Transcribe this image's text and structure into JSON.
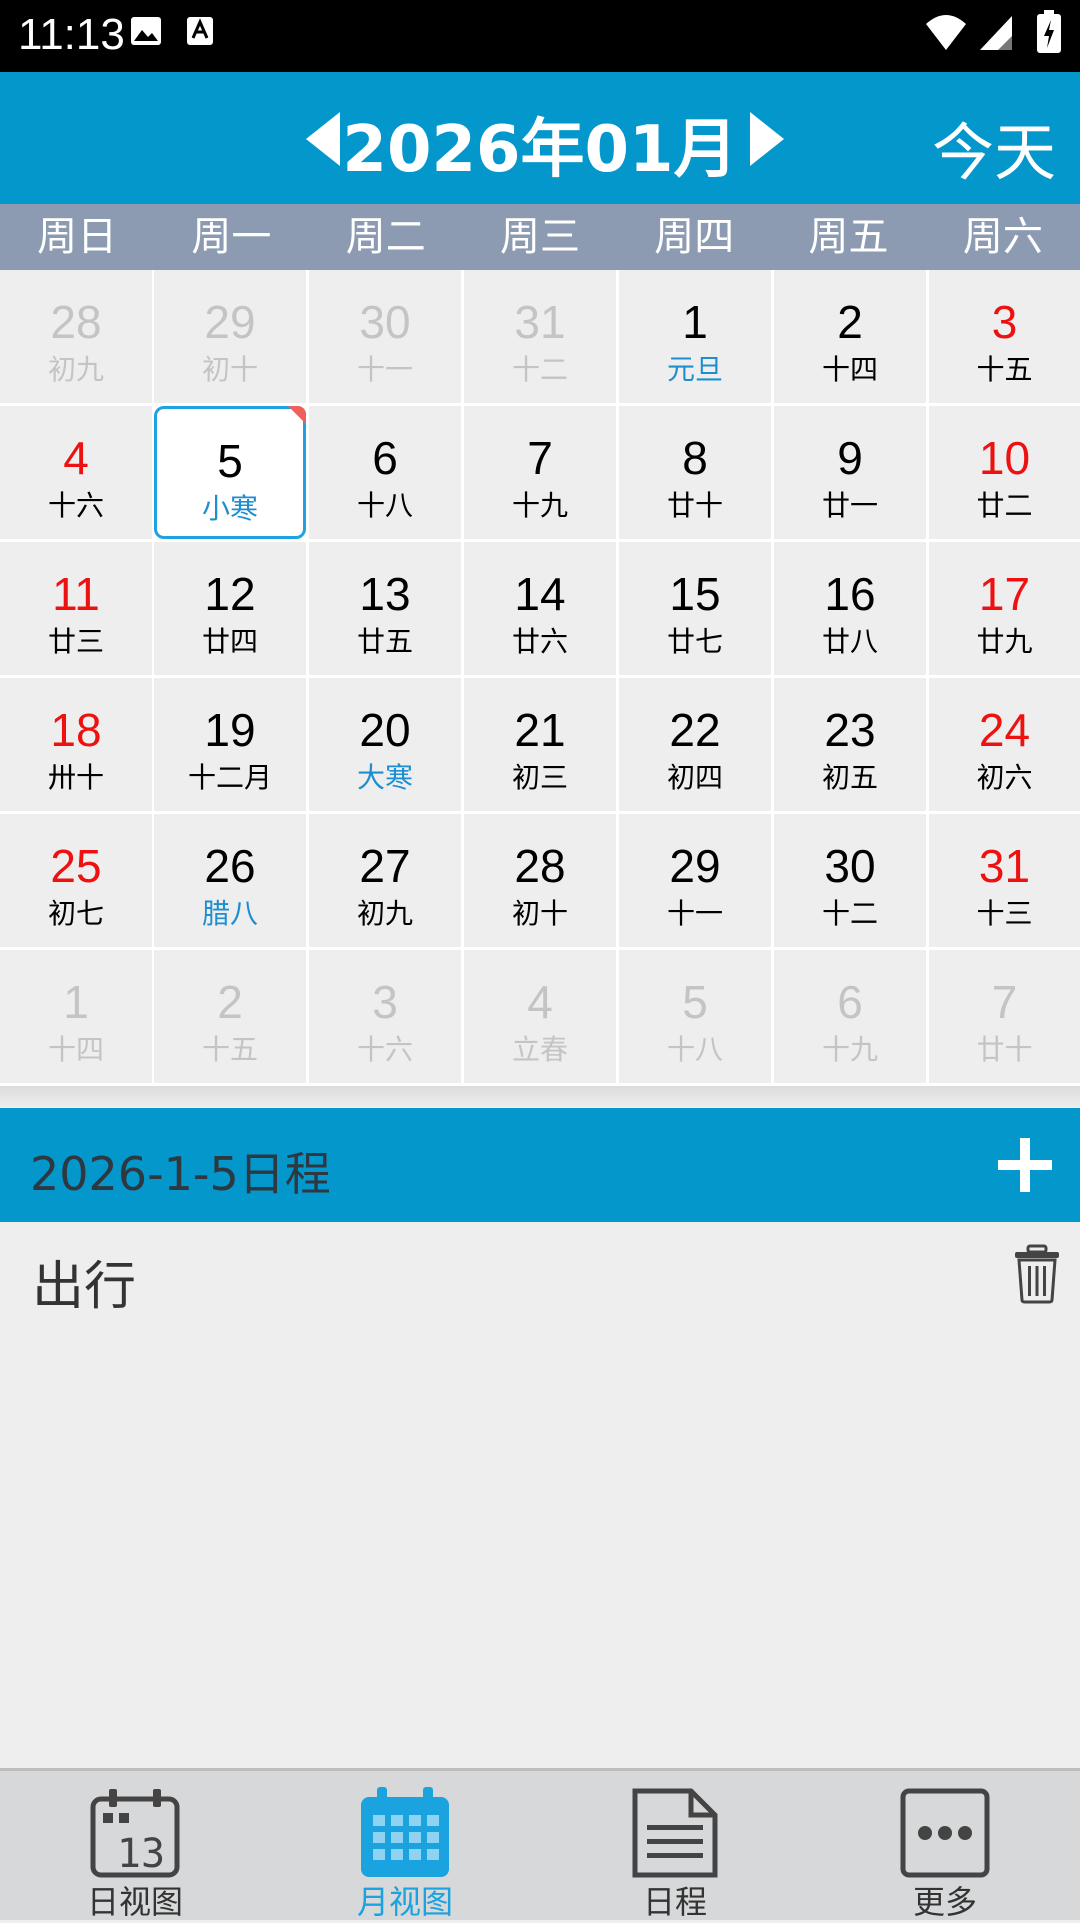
{
  "status": {
    "time": "11:13"
  },
  "header": {
    "month": "2026年01月",
    "today": "今天"
  },
  "weekdays": [
    "周日",
    "周一",
    "周二",
    "周三",
    "周四",
    "周五",
    "周六"
  ],
  "days": [
    {
      "num": "28",
      "lunar": "初九",
      "dim": true
    },
    {
      "num": "29",
      "lunar": "初十",
      "dim": true
    },
    {
      "num": "30",
      "lunar": "十一",
      "dim": true
    },
    {
      "num": "31",
      "lunar": "十二",
      "dim": true
    },
    {
      "num": "1",
      "lunar": "元旦",
      "festival": true
    },
    {
      "num": "2",
      "lunar": "十四"
    },
    {
      "num": "3",
      "lunar": "十五",
      "weekend": true
    },
    {
      "num": "4",
      "lunar": "十六",
      "weekend": true
    },
    {
      "num": "5",
      "lunar": "小寒",
      "festival": true,
      "selected": true,
      "hasEvent": true
    },
    {
      "num": "6",
      "lunar": "十八"
    },
    {
      "num": "7",
      "lunar": "十九"
    },
    {
      "num": "8",
      "lunar": "廿十"
    },
    {
      "num": "9",
      "lunar": "廿一"
    },
    {
      "num": "10",
      "lunar": "廿二",
      "weekend": true
    },
    {
      "num": "11",
      "lunar": "廿三",
      "weekend": true
    },
    {
      "num": "12",
      "lunar": "廿四"
    },
    {
      "num": "13",
      "lunar": "廿五"
    },
    {
      "num": "14",
      "lunar": "廿六"
    },
    {
      "num": "15",
      "lunar": "廿七"
    },
    {
      "num": "16",
      "lunar": "廿八"
    },
    {
      "num": "17",
      "lunar": "廿九",
      "weekend": true
    },
    {
      "num": "18",
      "lunar": "卅十",
      "weekend": true
    },
    {
      "num": "19",
      "lunar": "十二月"
    },
    {
      "num": "20",
      "lunar": "大寒",
      "festival": true
    },
    {
      "num": "21",
      "lunar": "初三"
    },
    {
      "num": "22",
      "lunar": "初四"
    },
    {
      "num": "23",
      "lunar": "初五"
    },
    {
      "num": "24",
      "lunar": "初六",
      "weekend": true
    },
    {
      "num": "25",
      "lunar": "初七",
      "weekend": true
    },
    {
      "num": "26",
      "lunar": "腊八",
      "festival": true
    },
    {
      "num": "27",
      "lunar": "初九"
    },
    {
      "num": "28",
      "lunar": "初十"
    },
    {
      "num": "29",
      "lunar": "十一"
    },
    {
      "num": "30",
      "lunar": "十二"
    },
    {
      "num": "31",
      "lunar": "十三",
      "weekend": true
    },
    {
      "num": "1",
      "lunar": "十四",
      "dim": true
    },
    {
      "num": "2",
      "lunar": "十五",
      "dim": true
    },
    {
      "num": "3",
      "lunar": "十六",
      "dim": true
    },
    {
      "num": "4",
      "lunar": "立春",
      "dim": true
    },
    {
      "num": "5",
      "lunar": "十八",
      "dim": true
    },
    {
      "num": "6",
      "lunar": "十九",
      "dim": true
    },
    {
      "num": "7",
      "lunar": "廿十",
      "dim": true
    }
  ],
  "schedule": {
    "title": "2026-1-5日程",
    "items": [
      {
        "text": "出行"
      }
    ]
  },
  "tabs": [
    {
      "label": "日视图",
      "icon": "day-view-icon",
      "icon_text": "13"
    },
    {
      "label": "月视图",
      "icon": "month-view-icon",
      "active": true
    },
    {
      "label": "日程",
      "icon": "schedule-icon"
    },
    {
      "label": "更多",
      "icon": "more-icon"
    }
  ],
  "colors": {
    "accent": "#0497cc",
    "weekday_bar": "#8c9bb2",
    "weekend": "#ee1111",
    "festival": "#1d8fd1",
    "tab_active": "#1aa3df"
  }
}
